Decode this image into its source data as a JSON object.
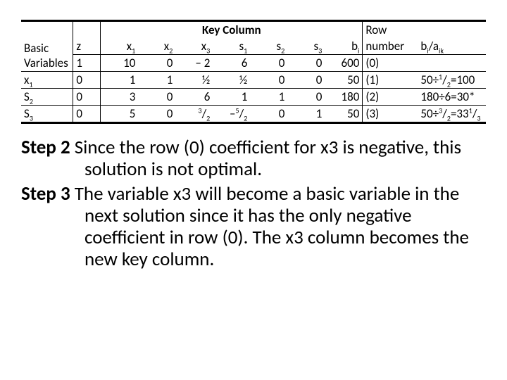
{
  "table": {
    "key_column_title": "Key Column",
    "hdr_basic": "Basic Variables",
    "hdr_z": "z",
    "hdr_x1": "x_1",
    "hdr_x2": "x_2",
    "hdr_x3": "x_3",
    "hdr_s1": "s_1",
    "hdr_s2": "s_2",
    "hdr_s3": "s_3",
    "hdr_bi": "b_i",
    "hdr_rownum_l1": "Row",
    "hdr_rownum_l2": "number",
    "hdr_ratio": "b_i/a_ik"
  },
  "rows": {
    "r0": {
      "bv": "1",
      "z": "",
      "x1": "10",
      "x2": "0",
      "x3": "– 2",
      "s1": "6",
      "s2": "0",
      "s3": "0",
      "bi": "600",
      "rn": "(0)",
      "ratio": ""
    },
    "r1": {
      "bv": "x_1",
      "z": "0",
      "x1": "1",
      "x2": "1",
      "x3": "½",
      "s1": "½",
      "s2": "0",
      "s3": "0",
      "bi": "50",
      "rn": "(1)",
      "ratio": "50÷^1/_2=100"
    },
    "r2": {
      "bv": "S_2",
      "z": "0",
      "x1": "3",
      "x2": "0",
      "x3": "6",
      "s1": "1",
      "s2": "1",
      "s3": "0",
      "bi": "180",
      "rn": "(2)",
      "ratio": "180÷6=30*"
    },
    "r3": {
      "bv": "S_3",
      "z": "0",
      "x1": "5",
      "x2": "0",
      "x3": "^3/_2",
      "s1": "–^5/_2",
      "s2": "0",
      "s3": "1",
      "bi": "50",
      "rn": "(3)",
      "ratio": "50÷^3/_2=33^1/_3"
    }
  },
  "steps": {
    "s2_label": "Step 2",
    "s2_text": " Since the row (0) coefficient for x3 is negative, this solution is not optimal.",
    "s3_label": "Step 3",
    "s3_text": " The variable x3 will become a basic variable in the next solution since it has the only negative coefficient in row (0). The x3 column becomes the new key column."
  }
}
